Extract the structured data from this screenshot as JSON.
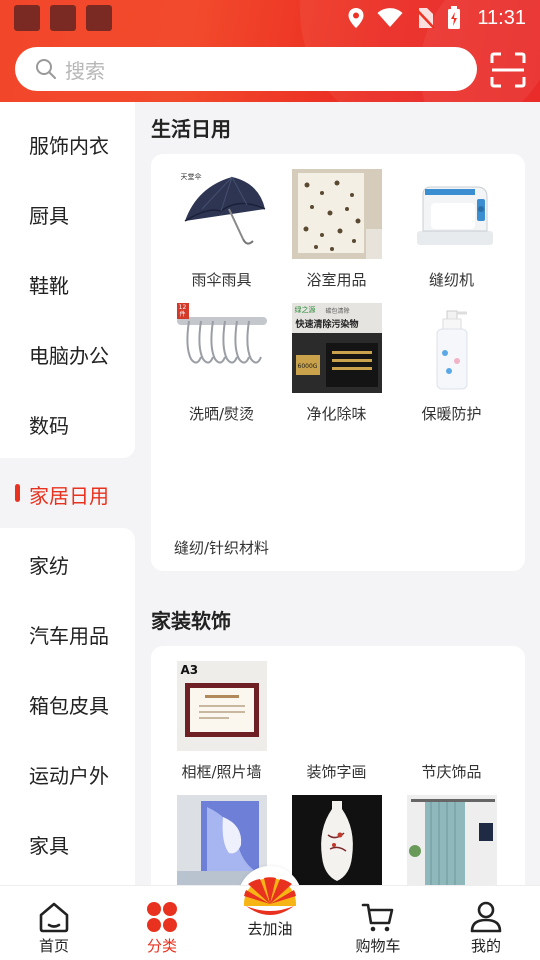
{
  "status_bar": {
    "time": "11:31"
  },
  "search": {
    "placeholder": "搜索"
  },
  "sidebar": {
    "items": [
      "服饰内衣",
      "厨具",
      "鞋靴",
      "电脑办公",
      "数码",
      "家居日用",
      "家纺",
      "汽车用品",
      "箱包皮具",
      "运动户外",
      "家具"
    ],
    "active_index": 5
  },
  "sections": [
    {
      "title": "生活日用",
      "categories": [
        "雨伞雨具",
        "浴室用品",
        "缝纫机",
        "洗晒/熨烫",
        "净化除味",
        "保暖防护",
        "缝纫/针织材料"
      ]
    },
    {
      "title": "家装软饰",
      "categories": [
        "相框/照片墙",
        "装饰字画",
        "节庆饰品"
      ]
    }
  ],
  "product_image_text": {
    "umbrella_brand": "天堂伞",
    "hooks_badge": "12件",
    "purifier_brand": "绿之源",
    "purifier_tag": "碳包清除",
    "purifier_title": "快速清除污染物",
    "purifier_weight": "6000G",
    "frame_label": "A3"
  },
  "bottom_nav": [
    "首页",
    "分类",
    "去加油",
    "购物车",
    "我的"
  ],
  "bottom_nav_active": 1,
  "colors": {
    "accent": "#e8321f",
    "header": "#ee3325"
  }
}
